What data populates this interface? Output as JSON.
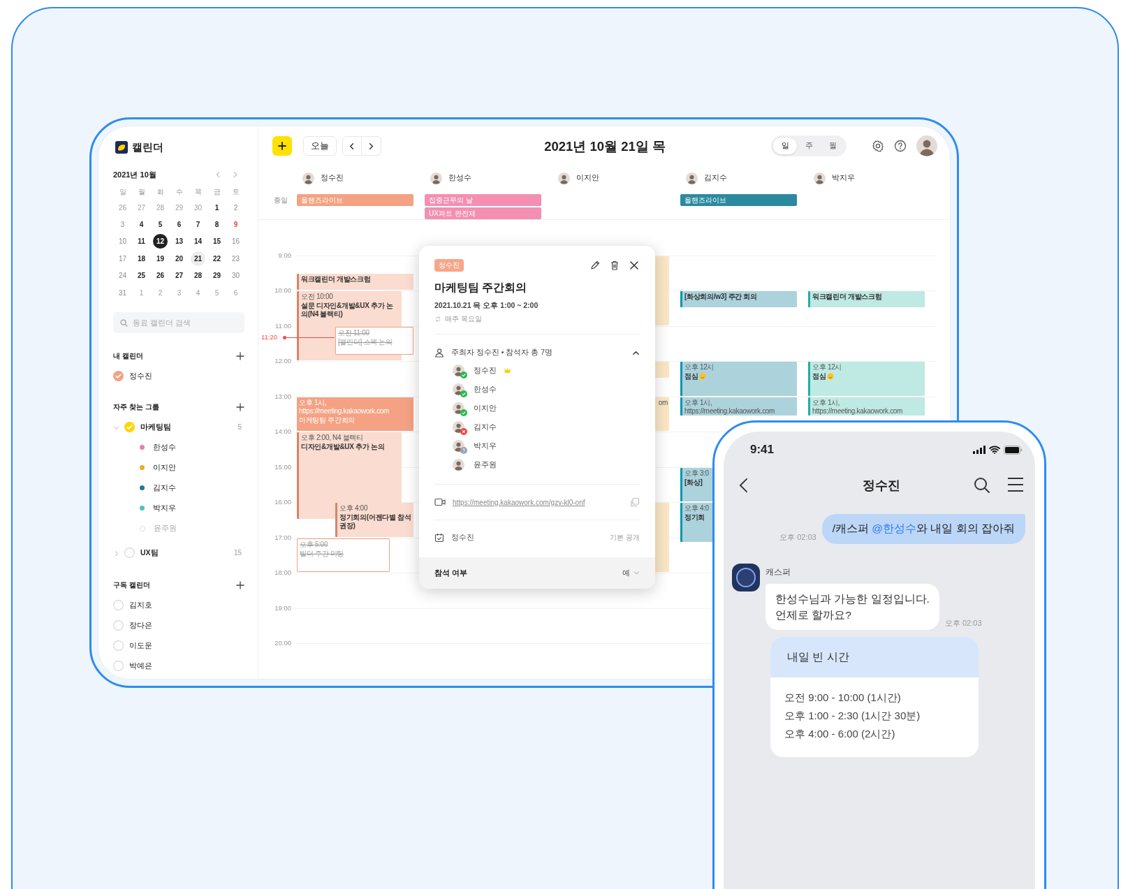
{
  "calendar_app": {
    "logo": {
      "text": "캘린더"
    },
    "mini_calendar": {
      "month": "2021년 10월",
      "weekdays": [
        "일",
        "월",
        "화",
        "수",
        "목",
        "금",
        "토"
      ],
      "weeks": [
        [
          {
            "d": "26",
            "kind": "other_month",
            "today": false,
            "selected": false
          },
          {
            "d": "27",
            "kind": "other_month",
            "today": false,
            "selected": false
          },
          {
            "d": "28",
            "kind": "other_month",
            "today": false,
            "selected": false
          },
          {
            "d": "29",
            "kind": "other_month",
            "today": false,
            "selected": false
          },
          {
            "d": "30",
            "kind": "other_month",
            "today": false,
            "selected": false
          },
          {
            "d": "1",
            "kind": "weekday",
            "today": false,
            "selected": false
          },
          {
            "d": "2",
            "kind": "weekend",
            "today": false,
            "selected": false
          }
        ],
        [
          {
            "d": "3",
            "kind": "weekend",
            "today": false,
            "selected": false
          },
          {
            "d": "4",
            "kind": "weekday",
            "today": false,
            "selected": false
          },
          {
            "d": "5",
            "kind": "weekday",
            "today": false,
            "selected": false
          },
          {
            "d": "6",
            "kind": "weekday",
            "today": false,
            "selected": false
          },
          {
            "d": "7",
            "kind": "weekday",
            "today": false,
            "selected": false
          },
          {
            "d": "8",
            "kind": "weekday",
            "today": false,
            "selected": false
          },
          {
            "d": "9",
            "kind": "holiday",
            "today": false,
            "selected": false
          }
        ],
        [
          {
            "d": "10",
            "kind": "weekend",
            "today": false,
            "selected": false
          },
          {
            "d": "11",
            "kind": "weekday",
            "today": false,
            "selected": false
          },
          {
            "d": "12",
            "kind": "weekday",
            "today": true,
            "selected": false
          },
          {
            "d": "13",
            "kind": "weekday",
            "today": false,
            "selected": false
          },
          {
            "d": "14",
            "kind": "weekday",
            "today": false,
            "selected": false
          },
          {
            "d": "15",
            "kind": "weekday",
            "today": false,
            "selected": false
          },
          {
            "d": "16",
            "kind": "weekend",
            "today": false,
            "selected": false
          }
        ],
        [
          {
            "d": "17",
            "kind": "weekend",
            "today": false,
            "selected": false
          },
          {
            "d": "18",
            "kind": "weekday",
            "today": false,
            "selected": false
          },
          {
            "d": "19",
            "kind": "weekday",
            "today": false,
            "selected": false
          },
          {
            "d": "20",
            "kind": "weekday",
            "today": false,
            "selected": false
          },
          {
            "d": "21",
            "kind": "weekday",
            "today": false,
            "selected": true
          },
          {
            "d": "22",
            "kind": "weekday",
            "today": false,
            "selected": false
          },
          {
            "d": "23",
            "kind": "weekend",
            "today": false,
            "selected": false
          }
        ],
        [
          {
            "d": "24",
            "kind": "weekend",
            "today": false,
            "selected": false
          },
          {
            "d": "25",
            "kind": "weekday",
            "today": false,
            "selected": false
          },
          {
            "d": "26",
            "kind": "weekday",
            "today": false,
            "selected": false
          },
          {
            "d": "27",
            "kind": "weekday",
            "today": false,
            "selected": false
          },
          {
            "d": "28",
            "kind": "weekday",
            "today": false,
            "selected": false
          },
          {
            "d": "29",
            "kind": "weekday",
            "today": false,
            "selected": false
          },
          {
            "d": "30",
            "kind": "weekend",
            "today": false,
            "selected": false
          }
        ],
        [
          {
            "d": "31",
            "kind": "weekend",
            "today": false,
            "selected": false
          },
          {
            "d": "1",
            "kind": "other_month",
            "today": false,
            "selected": false
          },
          {
            "d": "2",
            "kind": "other_month",
            "today": false,
            "selected": false
          },
          {
            "d": "3",
            "kind": "other_month",
            "today": false,
            "selected": false
          },
          {
            "d": "4",
            "kind": "other_month",
            "today": false,
            "selected": false
          },
          {
            "d": "5",
            "kind": "other_month",
            "today": false,
            "selected": false
          },
          {
            "d": "6",
            "kind": "other_month",
            "today": false,
            "selected": false
          }
        ]
      ]
    },
    "search": {
      "placeholder": "동료 캘린더 검색"
    },
    "my_calendars": {
      "title": "내 캘린더",
      "items": [
        {
          "name": "정수진",
          "checked": true,
          "color": "#f4a283"
        }
      ]
    },
    "groups": {
      "title": "자주 찾는 그룹",
      "items": [
        {
          "name": "마케팅팀",
          "checked": true,
          "color": "#ffd600",
          "expanded": true,
          "count": "5",
          "members": [
            {
              "name": "한성수",
              "checked": true,
              "color": "#f27ba3"
            },
            {
              "name": "이지안",
              "checked": true,
              "color": "#f5a623"
            },
            {
              "name": "김지수",
              "checked": true,
              "color": "#1f7a94"
            },
            {
              "name": "박지우",
              "checked": true,
              "color": "#4cc3b5"
            },
            {
              "name": "윤주원",
              "checked": false
            }
          ]
        },
        {
          "name": "UX팀",
          "checked": false,
          "expanded": false,
          "count": "15"
        }
      ]
    },
    "subscribed": {
      "title": "구독 캘린더",
      "items": [
        {
          "name": "김지호",
          "checked": false
        },
        {
          "name": "장다은",
          "checked": false
        },
        {
          "name": "이도운",
          "checked": false
        },
        {
          "name": "박예은",
          "checked": false
        }
      ]
    },
    "toolbar": {
      "today_button": "오늘",
      "date_title": "2021년 10월 21일 목",
      "views": [
        {
          "label": "일",
          "selected": true
        },
        {
          "label": "주",
          "selected": false
        },
        {
          "label": "월",
          "selected": false
        }
      ]
    },
    "all_day_label": "종일",
    "hours": [
      "9:00",
      "10:00",
      "11:00",
      "12:00",
      "13:00",
      "14:00",
      "15:00",
      "16:00",
      "17:00",
      "18:00",
      "19:00",
      "20:00"
    ],
    "now": {
      "label": "11:20"
    },
    "people": [
      {
        "name": "정수진",
        "all_day": [
          {
            "title": "올핸즈라이브",
            "color": "#f4a283"
          }
        ],
        "events": [
          {
            "title": "워크캘린더 개발스크럼",
            "color": "#fbdcd0",
            "selected": false,
            "declined": false
          },
          {
            "time": "오전 10:00",
            "title": "설문 디자인&개발&UX 추가 논의(N4 블랙티)",
            "color": "#fbdcd0",
            "selected": false,
            "declined": false
          },
          {
            "time": "오전 11:00",
            "title": "[캘린더] 스펙 논의",
            "color": "#f4a283",
            "selected": false,
            "declined": true
          },
          {
            "time": "오후 1시, https://meeting.kakaowork.com",
            "title": "마케팅팀 주간회의",
            "color": "#f4a283",
            "selected": true,
            "declined": false
          },
          {
            "time": "오후 2:00, N4 블랙티",
            "title": "디자인&개발&UX 추가 논의",
            "color": "#fbdcd0",
            "selected": false,
            "declined": false
          },
          {
            "time": "오후 4:00",
            "title": "정기회의(어젠다별 참석 권장)",
            "color": "#fbdcd0",
            "selected": false,
            "declined": false
          },
          {
            "time": "오후 5:00",
            "title": "빌더 주간 미팅",
            "color": "#f4a283",
            "selected": false,
            "declined": true
          }
        ]
      },
      {
        "name": "한성수",
        "all_day": [
          {
            "title": "집중근무의 날",
            "color": "#f48fb1"
          },
          {
            "title": "UX파트 완전체",
            "color": "#f48fb1"
          }
        ]
      },
      {
        "name": "이지안",
        "events": [
          {
            "color": "#fbe7c6"
          },
          {
            "color": "#fbe7c6"
          },
          {
            "time": "om",
            "color": "#fbe7c6"
          },
          {
            "color": "#fbe7c6"
          }
        ]
      },
      {
        "name": "김지수",
        "all_day": [
          {
            "title": "올핸즈라이브",
            "color": "#2b8a9e"
          }
        ],
        "events": [
          {
            "title": "[화상회의/w3] 주간 회의",
            "color": "#acd2dc",
            "selected": false,
            "declined": false
          },
          {
            "time": "오후 12시",
            "title": "점심",
            "emoji": true,
            "color": "#acd2dc",
            "selected": false,
            "declined": false
          },
          {
            "time": "오후 1시, https://meeting.kakaowork.com",
            "color": "#acd2dc",
            "selected": false,
            "declined": false
          },
          {
            "time": "오후 3:0",
            "title": "[화상]",
            "color": "#acd2dc",
            "selected": false,
            "declined": false
          },
          {
            "time": "오후 4:0",
            "title": "정기회",
            "color": "#acd2dc",
            "selected": false,
            "declined": false
          }
        ]
      },
      {
        "name": "박지우",
        "events": [
          {
            "title": "워크캘린더 개발스크럼",
            "color": "#bfe9e3",
            "selected": false,
            "declined": false
          },
          {
            "time": "오후 12시",
            "title": "점심",
            "emoji": true,
            "color": "#bfe9e3",
            "selected": false,
            "declined": false
          },
          {
            "time": "오후 1시, https://meeting.kakaowork.com",
            "color": "#bfe9e3",
            "selected": false,
            "declined": false
          }
        ]
      }
    ]
  },
  "event_popup": {
    "calendar_tag": "정수진",
    "title": "마케팅팀 주간회의",
    "when": "2021.10.21 목 오후 1:00 ~ 2:00",
    "repeat": "매주 목요일",
    "attendees_summary": "주최자 정수진 • 참석자 총 7명",
    "attendees_expanded": true,
    "attendees": [
      {
        "name": "정수진",
        "kind": "accepted",
        "host": true
      },
      {
        "name": "한성수",
        "kind": "accepted",
        "host": false
      },
      {
        "name": "이지안",
        "kind": "accepted",
        "host": false
      },
      {
        "name": "김지수",
        "kind": "declined",
        "host": false
      },
      {
        "name": "박지우",
        "kind": "pending",
        "host": false
      },
      {
        "name": "윤주원",
        "kind": "none",
        "host": false
      }
    ],
    "meeting_link": "https://meeting.kakaowork.com/gzv-kl0-onf",
    "calendar": "정수진",
    "visibility": "기본 공개",
    "rsvp_label": "참석 여부",
    "rsvp_value": "예"
  },
  "phone": {
    "time": "9:41",
    "title": "정수진",
    "messages": [
      {
        "kind": "sent",
        "parts": [
          {
            "text": "/캐스퍼 ",
            "mention": false
          },
          {
            "text": "@한성수",
            "mention": true
          },
          {
            "text": "와 내일 회의 잡아줘",
            "mention": false
          }
        ],
        "time": "오후 02:03"
      },
      {
        "kind": "received",
        "sender": "캐스퍼",
        "text": "한성수님과 가능한 일정입니다.\n언제로 할까요?",
        "time": "오후 02:03"
      },
      {
        "kind": "card",
        "title": "내일 빈 시간",
        "lines": [
          "오전 9:00 - 10:00 (1시간)",
          "오후 1:00 - 2:30 (1시간 30분)",
          "오후 4:00 - 6:00 (2시간)"
        ]
      }
    ]
  }
}
